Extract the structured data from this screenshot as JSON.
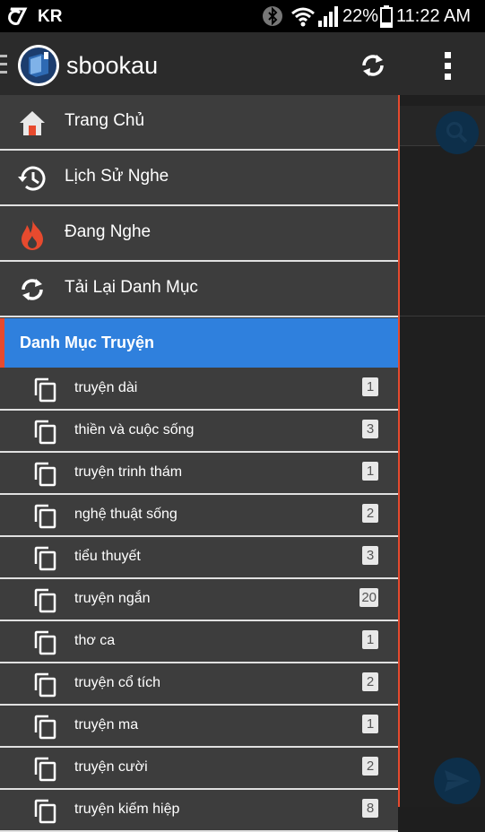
{
  "status_bar": {
    "carrier": "KR",
    "battery": "22%",
    "time": "11:22 AM"
  },
  "toolbar": {
    "title": "sbookau"
  },
  "nav": [
    {
      "label": "Trang Chủ",
      "icon": "home-icon"
    },
    {
      "label": "Lịch Sử Nghe",
      "icon": "history-icon"
    },
    {
      "label": "Đang Nghe",
      "icon": "flame-icon"
    },
    {
      "label": "Tải Lại Danh Mục",
      "icon": "refresh-icon"
    }
  ],
  "section": {
    "title": "Danh Mục Truyện"
  },
  "categories": [
    {
      "label": "truyện dài",
      "count": "1"
    },
    {
      "label": "thiền và cuộc sống",
      "count": "3"
    },
    {
      "label": "truyện trinh thám",
      "count": "1"
    },
    {
      "label": "nghệ thuật sống",
      "count": "2"
    },
    {
      "label": "tiểu thuyết",
      "count": "3"
    },
    {
      "label": "truyện ngắn",
      "count": "20"
    },
    {
      "label": "thơ ca",
      "count": "1"
    },
    {
      "label": "truyện cổ tích",
      "count": "2"
    },
    {
      "label": "truyện ma",
      "count": "1"
    },
    {
      "label": "truyện cười",
      "count": "2"
    },
    {
      "label": "truyện kiếm hiệp",
      "count": "8"
    }
  ],
  "colors": {
    "drawer_bg": "#3d3d3d",
    "section_bg": "#2f80dd",
    "accent": "#e74a2e"
  }
}
